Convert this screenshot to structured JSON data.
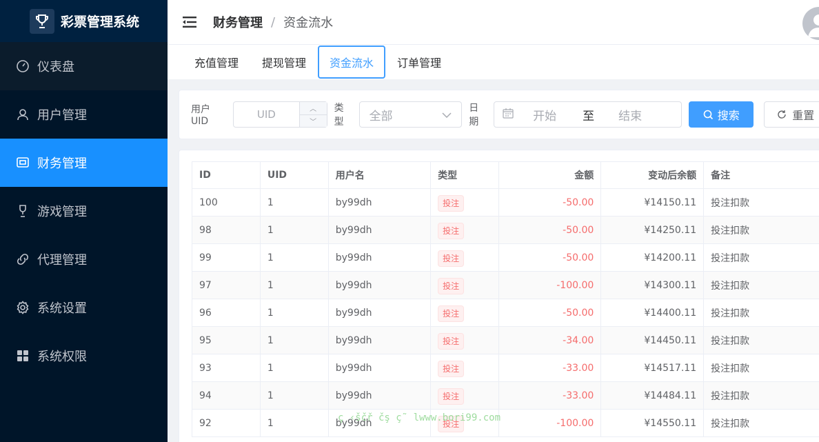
{
  "app": {
    "title": "彩票管理系统"
  },
  "sidebar": {
    "items": [
      {
        "label": "仪表盘",
        "icon": "dashboard-icon"
      },
      {
        "label": "用户管理",
        "icon": "user-icon"
      },
      {
        "label": "财务管理",
        "icon": "wallet-icon"
      },
      {
        "label": "游戏管理",
        "icon": "trophy-icon"
      },
      {
        "label": "代理管理",
        "icon": "link-icon"
      },
      {
        "label": "系统设置",
        "icon": "gear-icon"
      },
      {
        "label": "系统权限",
        "icon": "grid-icon"
      }
    ],
    "active_index": 2
  },
  "header": {
    "breadcrumb_1": "财务管理",
    "breadcrumb_sep": "/",
    "breadcrumb_2": "资金流水"
  },
  "tabs": [
    {
      "label": "充值管理"
    },
    {
      "label": "提现管理"
    },
    {
      "label": "资金流水"
    },
    {
      "label": "订单管理"
    }
  ],
  "search": {
    "uid_label": "用户UID",
    "uid_placeholder": "UID",
    "type_label": "类型",
    "type_value": "全部",
    "date_label": "日期",
    "date_start": "开始",
    "date_to": "至",
    "date_end": "结束",
    "search_button": "搜索",
    "reset_button": "重置"
  },
  "table": {
    "columns": [
      "ID",
      "UID",
      "用户名",
      "类型",
      "金额",
      "变动后余额",
      "备注"
    ],
    "rows": [
      {
        "id": "100",
        "uid": "1",
        "username": "by99dh",
        "type": "投注",
        "amount": "-50.00",
        "balance": "¥14150.11",
        "remark": "投注扣款"
      },
      {
        "id": "98",
        "uid": "1",
        "username": "by99dh",
        "type": "投注",
        "amount": "-50.00",
        "balance": "¥14250.11",
        "remark": "投注扣款"
      },
      {
        "id": "99",
        "uid": "1",
        "username": "by99dh",
        "type": "投注",
        "amount": "-50.00",
        "balance": "¥14200.11",
        "remark": "投注扣款"
      },
      {
        "id": "97",
        "uid": "1",
        "username": "by99dh",
        "type": "投注",
        "amount": "-100.00",
        "balance": "¥14300.11",
        "remark": "投注扣款"
      },
      {
        "id": "96",
        "uid": "1",
        "username": "by99dh",
        "type": "投注",
        "amount": "-50.00",
        "balance": "¥14400.11",
        "remark": "投注扣款"
      },
      {
        "id": "95",
        "uid": "1",
        "username": "by99dh",
        "type": "投注",
        "amount": "-34.00",
        "balance": "¥14450.11",
        "remark": "投注扣款"
      },
      {
        "id": "93",
        "uid": "1",
        "username": "by99dh",
        "type": "投注",
        "amount": "-33.00",
        "balance": "¥14517.11",
        "remark": "投注扣款"
      },
      {
        "id": "94",
        "uid": "1",
        "username": "by99dh",
        "type": "投注",
        "amount": "-33.00",
        "balance": "¥14484.11",
        "remark": "投注扣款"
      },
      {
        "id": "92",
        "uid": "1",
        "username": "by99dh",
        "type": "投注",
        "amount": "-100.00",
        "balance": "¥14550.11",
        "remark": "投注扣款"
      }
    ]
  },
  "watermark": "ç ‹ščř čş ç˜ lwww.bori99.com",
  "colors": {
    "sidebar_bg": "#001529",
    "active": "#1890ff",
    "primary": "#409eff",
    "danger": "#f56c6c"
  }
}
